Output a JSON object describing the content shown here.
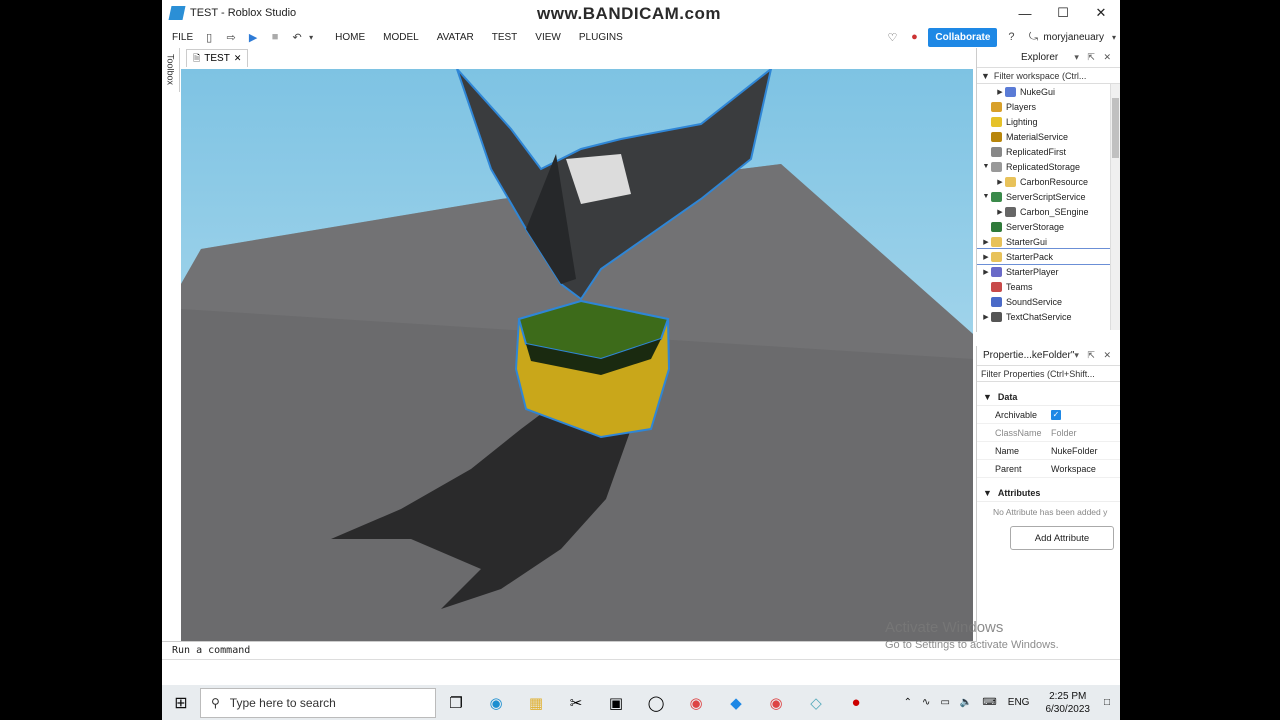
{
  "window": {
    "title": "TEST - Roblox Studio",
    "watermark": "www.BANDICAM.com",
    "controls": [
      "minimize-icon",
      "maximize-icon",
      "close-icon"
    ]
  },
  "ribbon": {
    "file": "FILE",
    "menus": [
      "HOME",
      "MODEL",
      "AVATAR",
      "TEST",
      "VIEW",
      "PLUGINS"
    ],
    "collaborate": "Collaborate",
    "user": "moryjaneuary"
  },
  "toolbox_label": "Toolbox",
  "tab": {
    "label": "TEST"
  },
  "command_bar": {
    "placeholder": "Run a command"
  },
  "explorer": {
    "title": "Explorer",
    "filter": "Filter workspace (Ctrl...",
    "items": [
      {
        "label": "NukeGui",
        "indent": 2,
        "arrow": "right",
        "icon": "gui-icon",
        "color": "#5a7bd6"
      },
      {
        "label": "Players",
        "indent": 1,
        "arrow": "",
        "icon": "players-icon",
        "color": "#d8a02a"
      },
      {
        "label": "Lighting",
        "indent": 1,
        "arrow": "",
        "icon": "lightbulb-icon",
        "color": "#e6c229"
      },
      {
        "label": "MaterialService",
        "indent": 1,
        "arrow": "",
        "icon": "material-icon",
        "color": "#b8860b"
      },
      {
        "label": "ReplicatedFirst",
        "indent": 1,
        "arrow": "",
        "icon": "replicated-icon",
        "color": "#888888"
      },
      {
        "label": "ReplicatedStorage",
        "indent": 1,
        "arrow": "down",
        "icon": "storage-icon",
        "color": "#999999"
      },
      {
        "label": "CarbonResource",
        "indent": 2,
        "arrow": "right",
        "icon": "folder-icon",
        "color": "#e8c25a"
      },
      {
        "label": "ServerScriptService",
        "indent": 1,
        "arrow": "down",
        "icon": "script-service-icon",
        "color": "#3a8a4a"
      },
      {
        "label": "Carbon_SEngine",
        "indent": 2,
        "arrow": "right",
        "icon": "script-icon",
        "color": "#666666"
      },
      {
        "label": "ServerStorage",
        "indent": 1,
        "arrow": "",
        "icon": "server-storage-icon",
        "color": "#2f7a3a"
      },
      {
        "label": "StarterGui",
        "indent": 1,
        "arrow": "right",
        "icon": "starter-gui-icon",
        "color": "#e8c25a"
      },
      {
        "label": "StarterPack",
        "indent": 1,
        "arrow": "right",
        "icon": "starter-pack-icon",
        "color": "#e8c25a",
        "selected": true
      },
      {
        "label": "StarterPlayer",
        "indent": 1,
        "arrow": "right",
        "icon": "starter-player-icon",
        "color": "#6a6ac8"
      },
      {
        "label": "Teams",
        "indent": 1,
        "arrow": "",
        "icon": "teams-icon",
        "color": "#c84a4a"
      },
      {
        "label": "SoundService",
        "indent": 1,
        "arrow": "",
        "icon": "sound-icon",
        "color": "#4a6ac8"
      },
      {
        "label": "TextChatService",
        "indent": 1,
        "arrow": "right",
        "icon": "chat-icon",
        "color": "#555555"
      }
    ]
  },
  "properties": {
    "title": "Propertie...keFolder\"",
    "filter": "Filter Properties (Ctrl+Shift...",
    "data_section": "Data",
    "rows": [
      {
        "key": "Archivable",
        "value": "",
        "checkbox": true
      },
      {
        "key": "ClassName",
        "value": "Folder",
        "gray": true
      },
      {
        "key": "Name",
        "value": "NukeFolder"
      },
      {
        "key": "Parent",
        "value": "Workspace"
      }
    ],
    "attributes_section": "Attributes",
    "no_attr": "No Attribute has been added y",
    "add_attribute": "Add Attribute"
  },
  "activation": {
    "title": "Activate Windows",
    "subtitle": "Go to Settings to activate Windows."
  },
  "taskbar": {
    "search_placeholder": "Type here to search",
    "language": "ENG",
    "time": "2:25 PM",
    "date": "6/30/2023"
  }
}
